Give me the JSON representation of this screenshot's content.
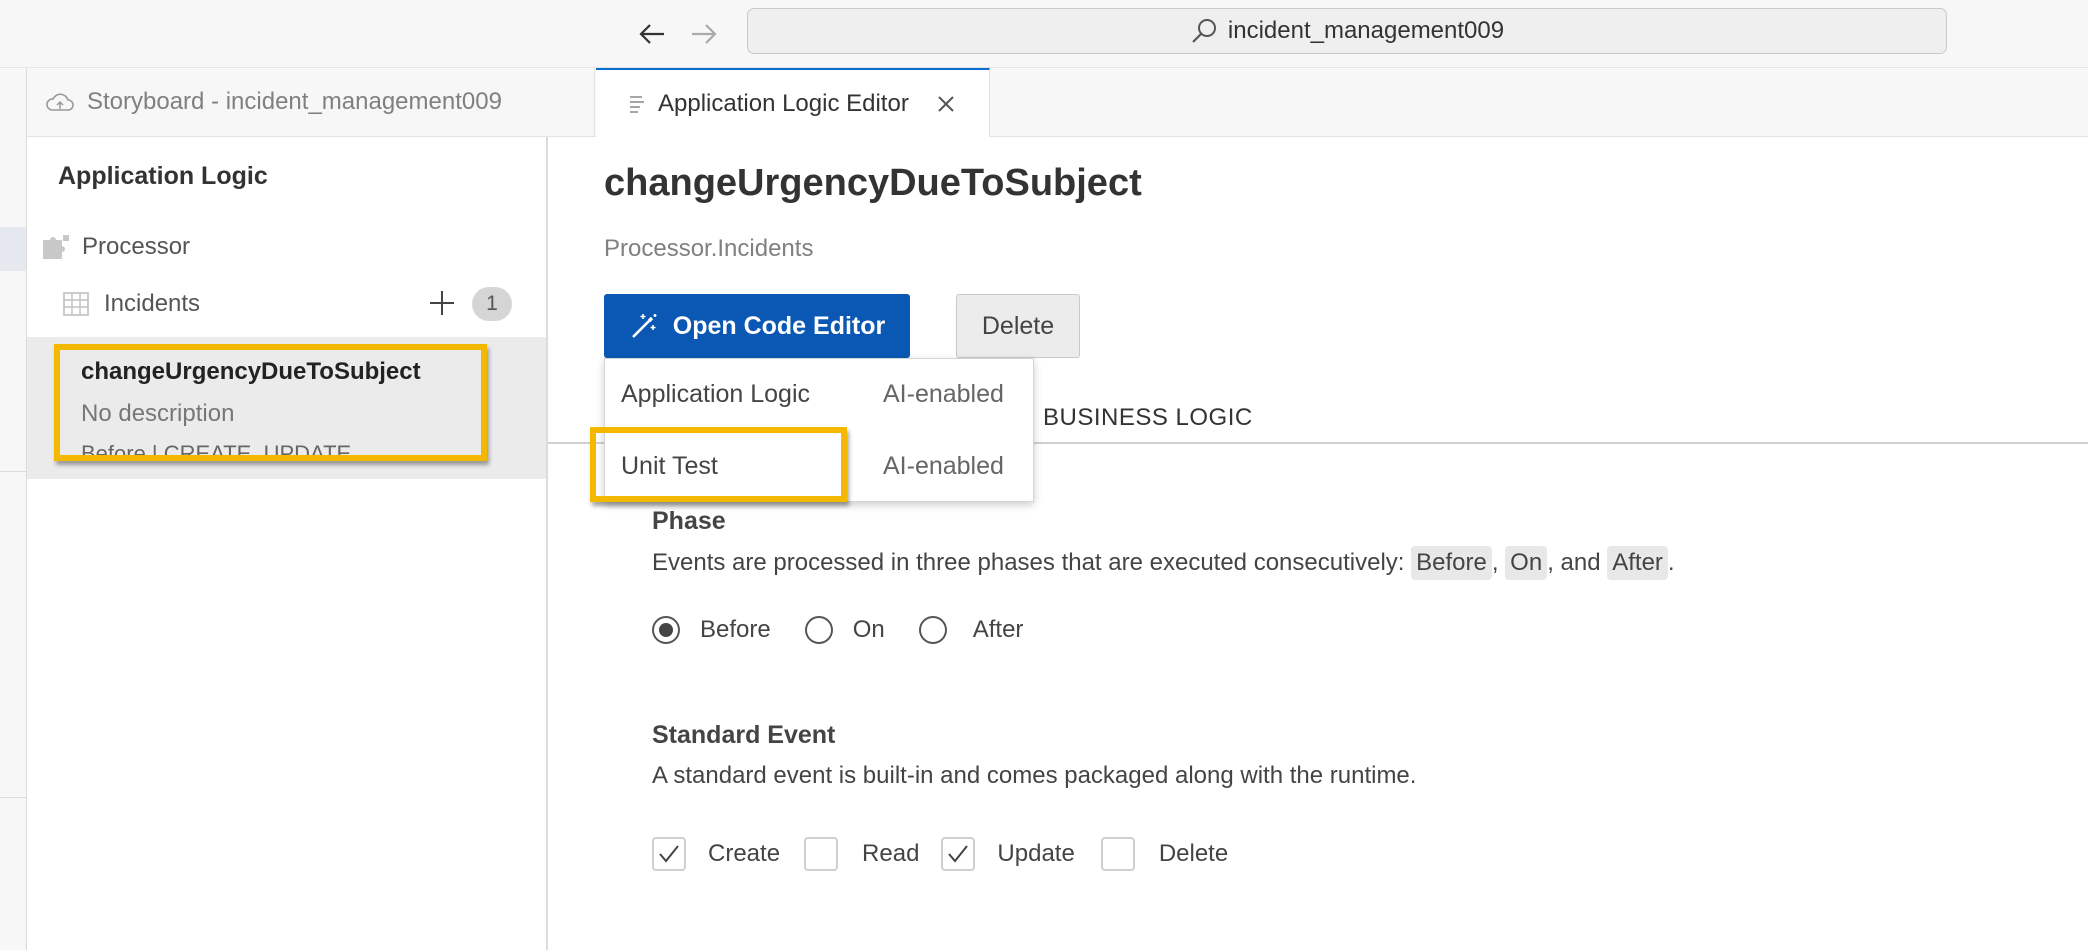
{
  "browser": {
    "back_icon": "arrow-left-icon",
    "forward_icon": "arrow-right-icon",
    "address": "incident_management009"
  },
  "tabs": [
    {
      "label": "Storyboard - incident_management009",
      "icon": "cloud-icon",
      "active": false
    },
    {
      "label": "Application Logic Editor",
      "icon": "document-icon",
      "active": true
    }
  ],
  "sidebar": {
    "title": "Application Logic",
    "service": {
      "label": "Processor",
      "icon": "puzzle-icon"
    },
    "entity": {
      "label": "Incidents",
      "icon": "table-icon",
      "count": "1"
    },
    "selected_item": {
      "name": "changeUrgencyDueToSubject",
      "description": "No description",
      "meta": "Before | CREATE, UPDATE"
    }
  },
  "main": {
    "title": "changeUrgencyDueToSubject",
    "subtitle": "Processor.Incidents",
    "open_code_editor_label": "Open Code Editor",
    "delete_label": "Delete",
    "dropdown": [
      {
        "label": "Application Logic",
        "tag": "AI-enabled"
      },
      {
        "label": "Unit Test",
        "tag": "AI-enabled"
      }
    ],
    "visible_tab": "BUSINESS LOGIC",
    "phase": {
      "title": "Phase",
      "desc_prefix": "Events are processed in three phases that are executed consecutively: ",
      "chip_before": "Before",
      "sep1": ", ",
      "chip_on": "On",
      "sep2": ", and ",
      "chip_after": "After",
      "desc_suffix": ".",
      "options": [
        "Before",
        "On",
        "After"
      ],
      "selected": "Before"
    },
    "standard_event": {
      "title": "Standard Event",
      "desc": "A standard event is built-in and comes packaged along with the runtime.",
      "options": [
        {
          "label": "Create",
          "checked": true
        },
        {
          "label": "Read",
          "checked": false
        },
        {
          "label": "Update",
          "checked": true
        },
        {
          "label": "Delete",
          "checked": false
        }
      ]
    }
  },
  "colors": {
    "accent": "#0b58b4",
    "highlight": "#f5b800"
  }
}
